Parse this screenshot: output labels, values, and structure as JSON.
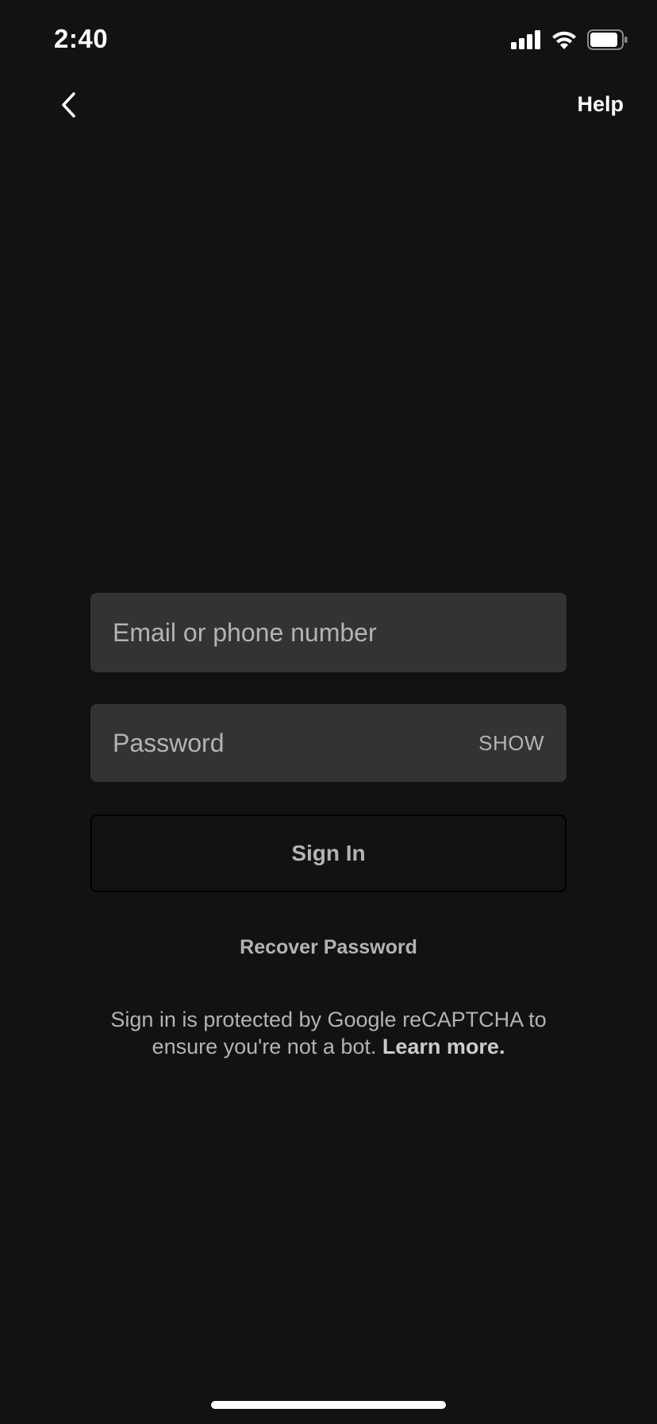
{
  "status_bar": {
    "time": "2:40",
    "icons": [
      "cellular-signal-icon",
      "wifi-icon",
      "battery-icon"
    ]
  },
  "nav": {
    "back_icon": "chevron-left-icon",
    "help_label": "Help"
  },
  "form": {
    "email_placeholder": "Email or phone number",
    "email_value": "",
    "password_placeholder": "Password",
    "password_value": "",
    "show_label": "SHOW",
    "sign_in_label": "Sign In"
  },
  "links": {
    "recover_password": "Recover Password"
  },
  "recaptcha": {
    "text": "Sign in is protected by Google reCAPTCHA to ensure you're not a bot. ",
    "learn_more": "Learn more."
  },
  "colors": {
    "background": "#121212",
    "field_background": "#333333",
    "muted_text": "#b3b3b3",
    "primary_text": "#ffffff"
  }
}
